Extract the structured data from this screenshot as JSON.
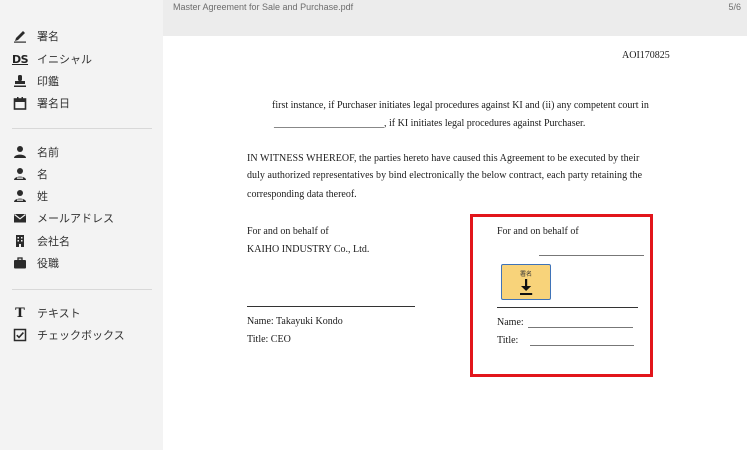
{
  "topbar": {
    "filename": "Master Agreement for Sale and Purchase.pdf",
    "page": "5/6"
  },
  "sidebar": {
    "group1": [
      {
        "label": "署名",
        "icon": "pen-icon"
      },
      {
        "label": "イニシャル",
        "icon": "ds-initials-icon",
        "icon_text": "DS"
      },
      {
        "label": "印鑑",
        "icon": "stamp-icon"
      },
      {
        "label": "署名日",
        "icon": "calendar-icon"
      }
    ],
    "group2": [
      {
        "label": "名前",
        "icon": "person-icon"
      },
      {
        "label": "名",
        "icon": "person-first-icon"
      },
      {
        "label": "姓",
        "icon": "person-last-icon"
      },
      {
        "label": "メールアドレス",
        "icon": "envelope-icon"
      },
      {
        "label": "会社名",
        "icon": "building-icon"
      },
      {
        "label": "役職",
        "icon": "briefcase-icon"
      }
    ],
    "group3": [
      {
        "label": "テキスト",
        "icon": "text-icon",
        "icon_text": "T"
      },
      {
        "label": "チェックボックス",
        "icon": "checkbox-icon"
      }
    ]
  },
  "document": {
    "ref": "AOI170825",
    "line1": "first instance, if Purchaser initiates legal procedures against KI and (ii) any competent court in",
    "line2": "______________________, if KI initiates legal procedures against Purchaser.",
    "witness1": "IN WITNESS WHEREOF, the parties hereto have caused this Agreement to be executed by their",
    "witness2": "duly authorized representatives by bind electronically the below contract, each party retaining the",
    "witness3": "corresponding data thereof.",
    "left": {
      "behalf": "For and on behalf of",
      "company": "KAIHO INDUSTRY Co., Ltd.",
      "name": "Name: Takayuki Kondo",
      "title": "Title: CEO"
    },
    "right": {
      "behalf": "For and on behalf of",
      "name": "Name:",
      "title": "Title:",
      "sign_button_label": "署名"
    }
  },
  "colors": {
    "highlight": "#e2151b",
    "sign_button_bg": "#f8d37a",
    "sign_button_border": "#3f73b8"
  }
}
